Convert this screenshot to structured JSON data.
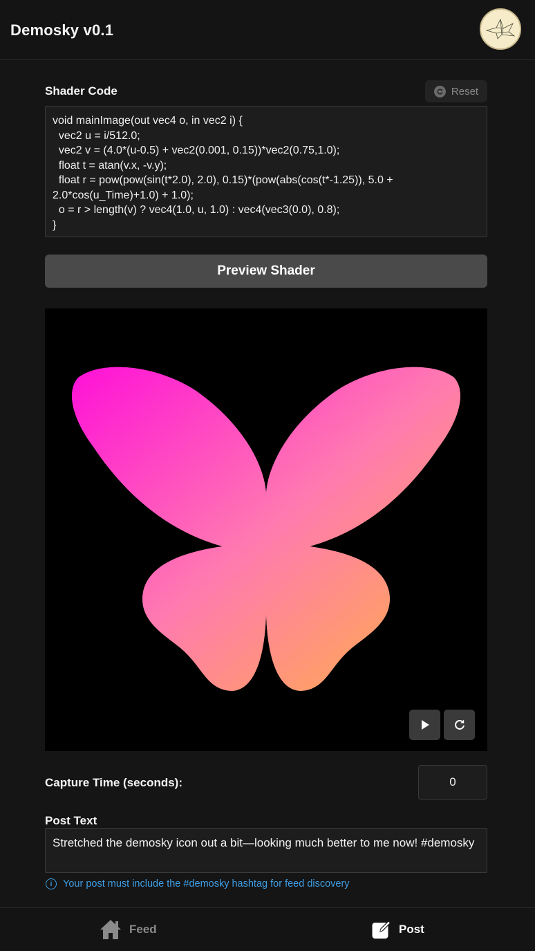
{
  "header": {
    "title": "Demosky v0.1",
    "avatar_icon": "paper-crane-icon"
  },
  "shader": {
    "label": "Shader Code",
    "reset_label": "Reset",
    "code": "void mainImage(out vec4 o, in vec2 i) {\n  vec2 u = i/512.0;\n  vec2 v = (4.0*(u-0.5) + vec2(0.001, 0.15))*vec2(0.75,1.0);\n  float t = atan(v.x, -v.y);\n  float r = pow(pow(sin(t*2.0), 2.0), 0.15)*(pow(abs(cos(t*-1.25)), 5.0 + 2.0*cos(u_Time)+1.0) + 1.0);\n  o = r > length(v) ? vec4(1.0, u, 1.0) : vec4(vec3(0.0), 0.8);\n}",
    "preview_label": "Preview Shader"
  },
  "preview": {
    "play_icon": "play-icon",
    "restart_icon": "restart-icon",
    "colors": {
      "background": "#000000",
      "top_left": "#ff10d8",
      "top_right": "#fff2d0",
      "bottom_left": "#ff2d5a",
      "bottom_right": "#ffb240"
    }
  },
  "capture": {
    "label": "Capture Time (seconds):",
    "value": "0"
  },
  "post": {
    "label": "Post Text",
    "text": "Stretched the demosky icon out a bit—looking much better to me now! #demosky",
    "hint": "Your post must include the #demosky hashtag for feed discovery"
  },
  "nav": {
    "items": [
      {
        "label": "Feed",
        "icon": "home-icon",
        "active": false
      },
      {
        "label": "Post",
        "icon": "compose-icon",
        "active": true
      }
    ]
  },
  "colors": {
    "accent": "#3f9fe6",
    "background": "#151515",
    "button": "#4a4a4a"
  }
}
